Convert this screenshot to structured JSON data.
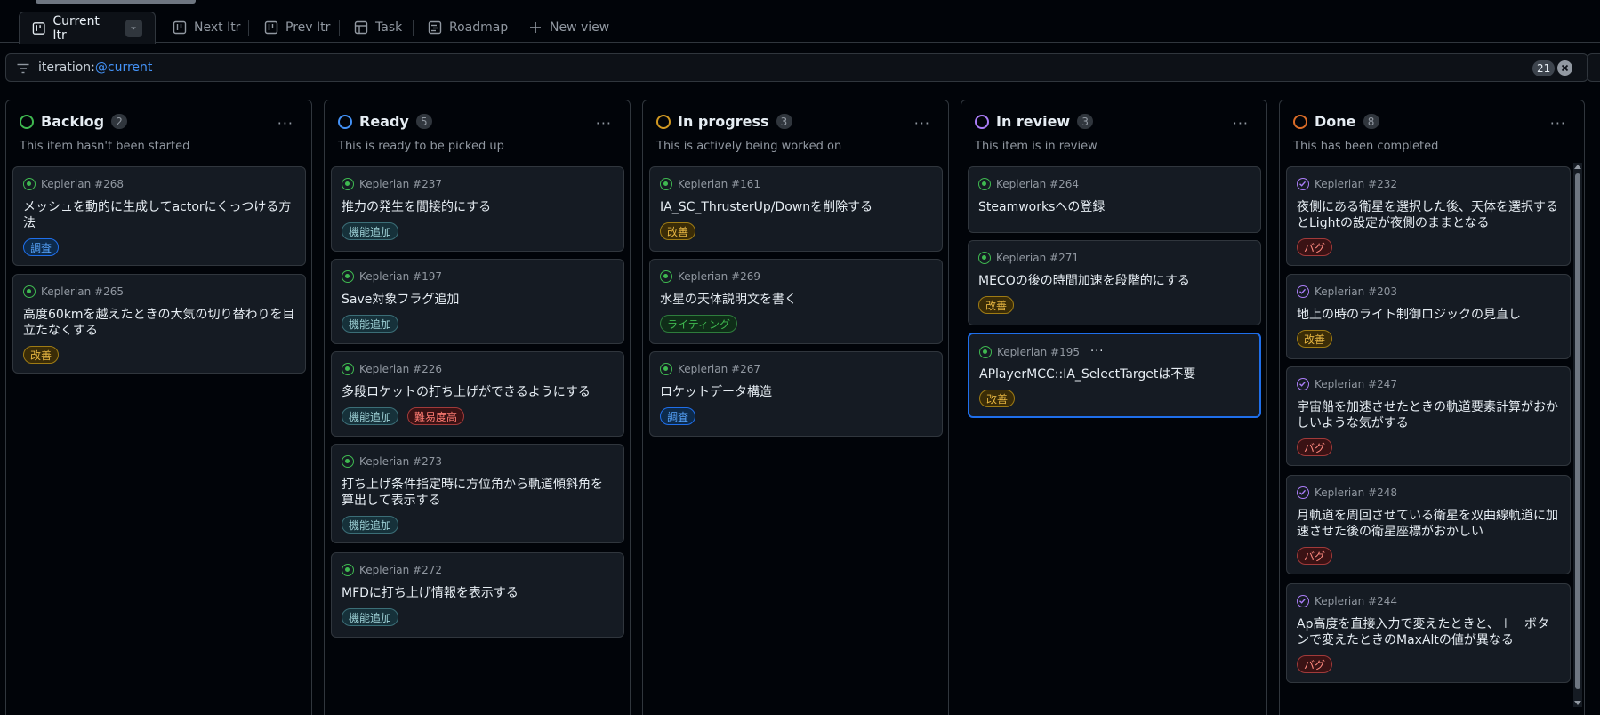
{
  "tabs": [
    {
      "label": "Current Itr",
      "active": true
    },
    {
      "label": "Next Itr"
    },
    {
      "label": "Prev Itr"
    },
    {
      "label": "Task"
    },
    {
      "label": "Roadmap"
    },
    {
      "label": "New view"
    }
  ],
  "filter": {
    "prefix": "iteration:",
    "token": "@current",
    "count": "21"
  },
  "columns": [
    {
      "title": "Backlog",
      "count": "2",
      "description": "This item hasn't been started",
      "color": "#3fb950"
    },
    {
      "title": "Ready",
      "count": "5",
      "description": "This is ready to be picked up",
      "color": "#4493f8"
    },
    {
      "title": "In progress",
      "count": "3",
      "description": "This is actively being worked on",
      "color": "#d29922"
    },
    {
      "title": "In review",
      "count": "3",
      "description": "This item is in review",
      "color": "#ab7df8"
    },
    {
      "title": "Done",
      "count": "8",
      "description": "This has been completed",
      "color": "#db6d28"
    }
  ],
  "cards": {
    "backlog": [
      {
        "ref": "Keplerian #268",
        "title": "メッシュを動的に生成してactorにくっつける方法",
        "labels": [
          "調査"
        ]
      },
      {
        "ref": "Keplerian #265",
        "title": "高度60kmを越えたときの大気の切り替わりを目立たなくする",
        "labels": [
          "改善"
        ]
      }
    ],
    "ready": [
      {
        "ref": "Keplerian #237",
        "title": "推力の発生を間接的にする",
        "labels": [
          "機能追加"
        ]
      },
      {
        "ref": "Keplerian #197",
        "title": "Save対象フラグ追加",
        "labels": [
          "機能追加"
        ]
      },
      {
        "ref": "Keplerian #226",
        "title": "多段ロケットの打ち上げができるようにする",
        "labels": [
          "機能追加",
          "難易度高"
        ]
      },
      {
        "ref": "Keplerian #273",
        "title": "打ち上げ条件指定時に方位角から軌道傾斜角を算出して表示する",
        "labels": [
          "機能追加"
        ]
      },
      {
        "ref": "Keplerian #272",
        "title": "MFDに打ち上げ情報を表示する",
        "labels": [
          "機能追加"
        ]
      }
    ],
    "progress": [
      {
        "ref": "Keplerian #161",
        "title": "IA_SC_ThrusterUp/Downを削除する",
        "labels": [
          "改善"
        ]
      },
      {
        "ref": "Keplerian #269",
        "title": "水星の天体説明文を書く",
        "labels": [
          "ライティング"
        ]
      },
      {
        "ref": "Keplerian #267",
        "title": "ロケットデータ構造",
        "labels": [
          "調査"
        ]
      }
    ],
    "review": [
      {
        "ref": "Keplerian #264",
        "title": "Steamworksへの登録",
        "labels": []
      },
      {
        "ref": "Keplerian #271",
        "title": "MECOの後の時間加速を段階的にする",
        "labels": [
          "改善"
        ]
      },
      {
        "ref": "Keplerian #195",
        "title": "APlayerMCC::IA_SelectTargetは不要",
        "labels": [
          "改善"
        ]
      }
    ],
    "done": [
      {
        "ref": "Keplerian #232",
        "title": "夜側にある衛星を選択した後、天体を選択するとLightの設定が夜側のままとなる",
        "labels": [
          "バグ"
        ]
      },
      {
        "ref": "Keplerian #203",
        "title": "地上の時のライト制御ロジックの見直し",
        "labels": [
          "改善"
        ]
      },
      {
        "ref": "Keplerian #247",
        "title": "宇宙船を加速させたときの軌道要素計算がおかしいような気がする",
        "labels": [
          "バグ"
        ]
      },
      {
        "ref": "Keplerian #248",
        "title": "月軌道を周回させている衛星を双曲線軌道に加速させた後の衛星座標がおかしい",
        "labels": [
          "バグ"
        ]
      },
      {
        "ref": "Keplerian #244",
        "title": "Ap高度を直接入力で変えたときと、＋－ボタンで変えたときのMaxAltの値が異なる",
        "labels": [
          "バグ"
        ]
      }
    ]
  },
  "label_colors": {
    "調査": {
      "fg": "#58a6ff",
      "bg": "#0d2a4a",
      "bd": "#1f6feb"
    },
    "改善": {
      "fg": "#e3b341",
      "bg": "#3a2c07",
      "bd": "#9e7b14"
    },
    "機能追加": {
      "fg": "#9fd3d8",
      "bg": "#16313a",
      "bd": "#3b6e77"
    },
    "難易度高": {
      "fg": "#ff7b72",
      "bg": "#3a1214",
      "bd": "#a13a3a"
    },
    "ライティング": {
      "fg": "#3fb950",
      "bg": "#0f2d18",
      "bd": "#2e7d3c"
    },
    "バグ": {
      "fg": "#ff8a80",
      "bg": "#3a1214",
      "bd": "#a13a3a"
    }
  }
}
